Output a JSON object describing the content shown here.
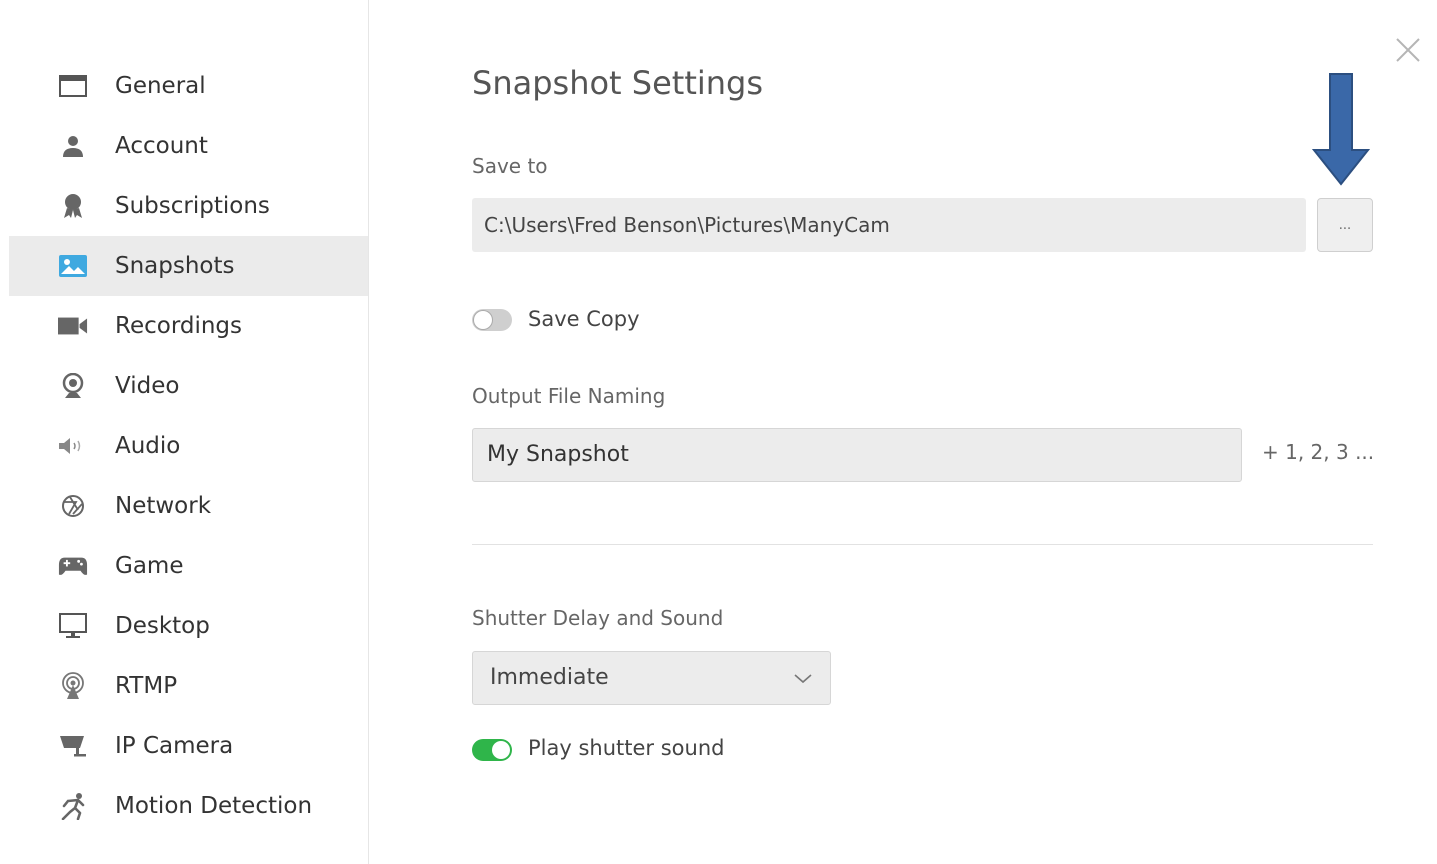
{
  "sidebar": {
    "items": [
      {
        "label": "General",
        "icon": "window-icon"
      },
      {
        "label": "Account",
        "icon": "user-icon"
      },
      {
        "label": "Subscriptions",
        "icon": "award-icon"
      },
      {
        "label": "Snapshots",
        "icon": "image-icon",
        "active": true
      },
      {
        "label": "Recordings",
        "icon": "video-camera-icon"
      },
      {
        "label": "Video",
        "icon": "webcam-icon"
      },
      {
        "label": "Audio",
        "icon": "speaker-icon"
      },
      {
        "label": "Network",
        "icon": "aperture-icon"
      },
      {
        "label": "Game",
        "icon": "gamepad-icon"
      },
      {
        "label": "Desktop",
        "icon": "monitor-icon"
      },
      {
        "label": "RTMP",
        "icon": "broadcast-icon"
      },
      {
        "label": "IP Camera",
        "icon": "security-camera-icon"
      },
      {
        "label": "Motion Detection",
        "icon": "running-person-icon"
      }
    ]
  },
  "main": {
    "title": "Snapshot Settings",
    "save_to": {
      "label": "Save to",
      "path": "C:\\Users\\Fred Benson\\Pictures\\ManyCam",
      "browse_label": "..."
    },
    "save_copy": {
      "label": "Save Copy",
      "enabled": false
    },
    "output_naming": {
      "label": "Output File Naming",
      "value": "My Snapshot",
      "suffix": "+ 1, 2, 3 ..."
    },
    "shutter": {
      "label": "Shutter Delay and Sound",
      "selected": "Immediate",
      "play_sound_label": "Play shutter sound",
      "play_sound_enabled": true
    }
  },
  "colors": {
    "accent_green": "#2fb54a",
    "active_icon_blue": "#3fa9e0",
    "annotation_arrow": "#3a68a8"
  }
}
